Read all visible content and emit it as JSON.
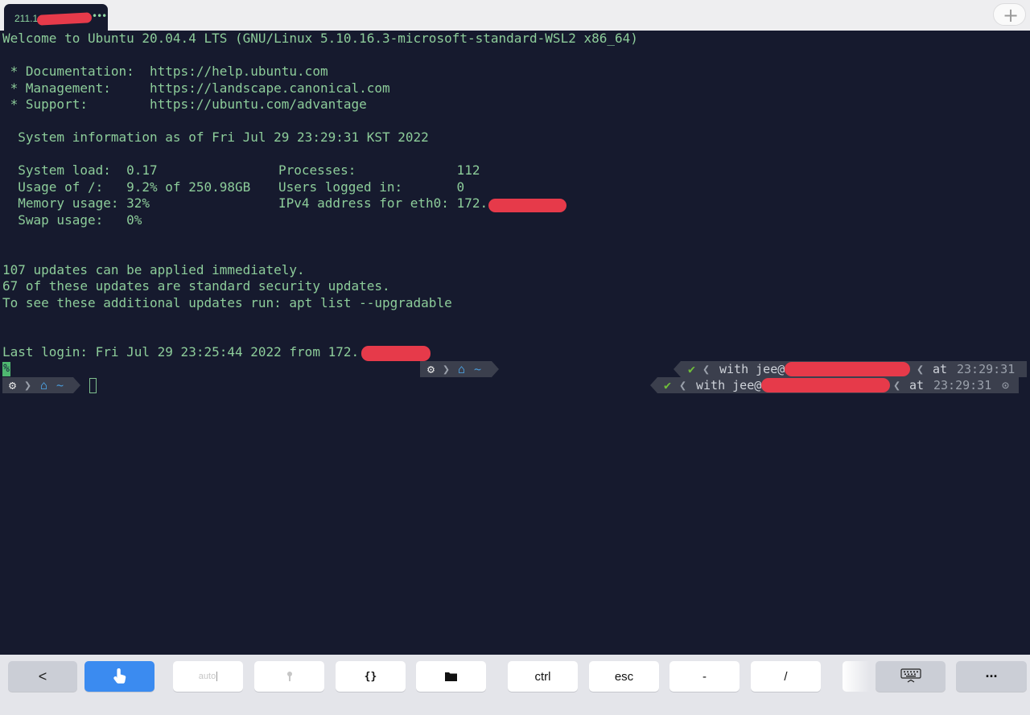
{
  "tab": {
    "title": "211.1",
    "more_icon": "ellipsis-icon",
    "new_tab_icon": "plus-icon",
    "new_tab_label": "+"
  },
  "terminal": {
    "lines": [
      "Welcome to Ubuntu 20.04.4 LTS (GNU/Linux 5.10.16.3-microsoft-standard-WSL2 x86_64)",
      " * Documentation:  https://help.ubuntu.com",
      " * Management:     https://landscape.canonical.com",
      " * Support:        https://ubuntu.com/advantage",
      "  System information as of Fri Jul 29 23:29:31 KST 2022",
      "  System load:  0.17",
      "  Usage of /:   9.2% of 250.98GB",
      "  Memory usage: 32%",
      "  Swap usage:   0%",
      "107 updates can be applied immediately.",
      "67 of these updates are standard security updates.",
      "To see these additional updates run: apt list --upgradable",
      "Last login: Fri Jul 29 23:25:44 2022 from 172."
    ],
    "sysinfo_right": [
      "Processes:             112",
      "Users logged in:       0",
      "IPv4 address for eth0: 172."
    ],
    "percent_marker": "%",
    "prompt": {
      "os_icon": "ubuntu-icon",
      "home_icon": "home-icon",
      "dir": "~"
    },
    "right_prompt_1": {
      "status": "✔",
      "with": "with jee@",
      "at": "at",
      "time": "23:29:31"
    },
    "right_prompt_2": {
      "status": "✔",
      "with": "with jee@",
      "at": "at",
      "time": "23:29:31",
      "clock_icon": "clock-icon"
    }
  },
  "keyboard_bar": {
    "back": "<",
    "touch_icon": "hand-pointer-icon",
    "auto_label": "auto",
    "key_icon": "key-icon",
    "braces": "{}",
    "folder_icon": "folder-icon",
    "ctrl": "ctrl",
    "esc": "esc",
    "dash": "-",
    "slash": "/",
    "keyboard_icon": "keyboard-icon",
    "more": "···"
  },
  "colors": {
    "terminal_bg": "#161a2e",
    "terminal_text": "#8dcd9a",
    "accent_blue": "#3b8bf0",
    "redaction": "#e63a4a"
  }
}
